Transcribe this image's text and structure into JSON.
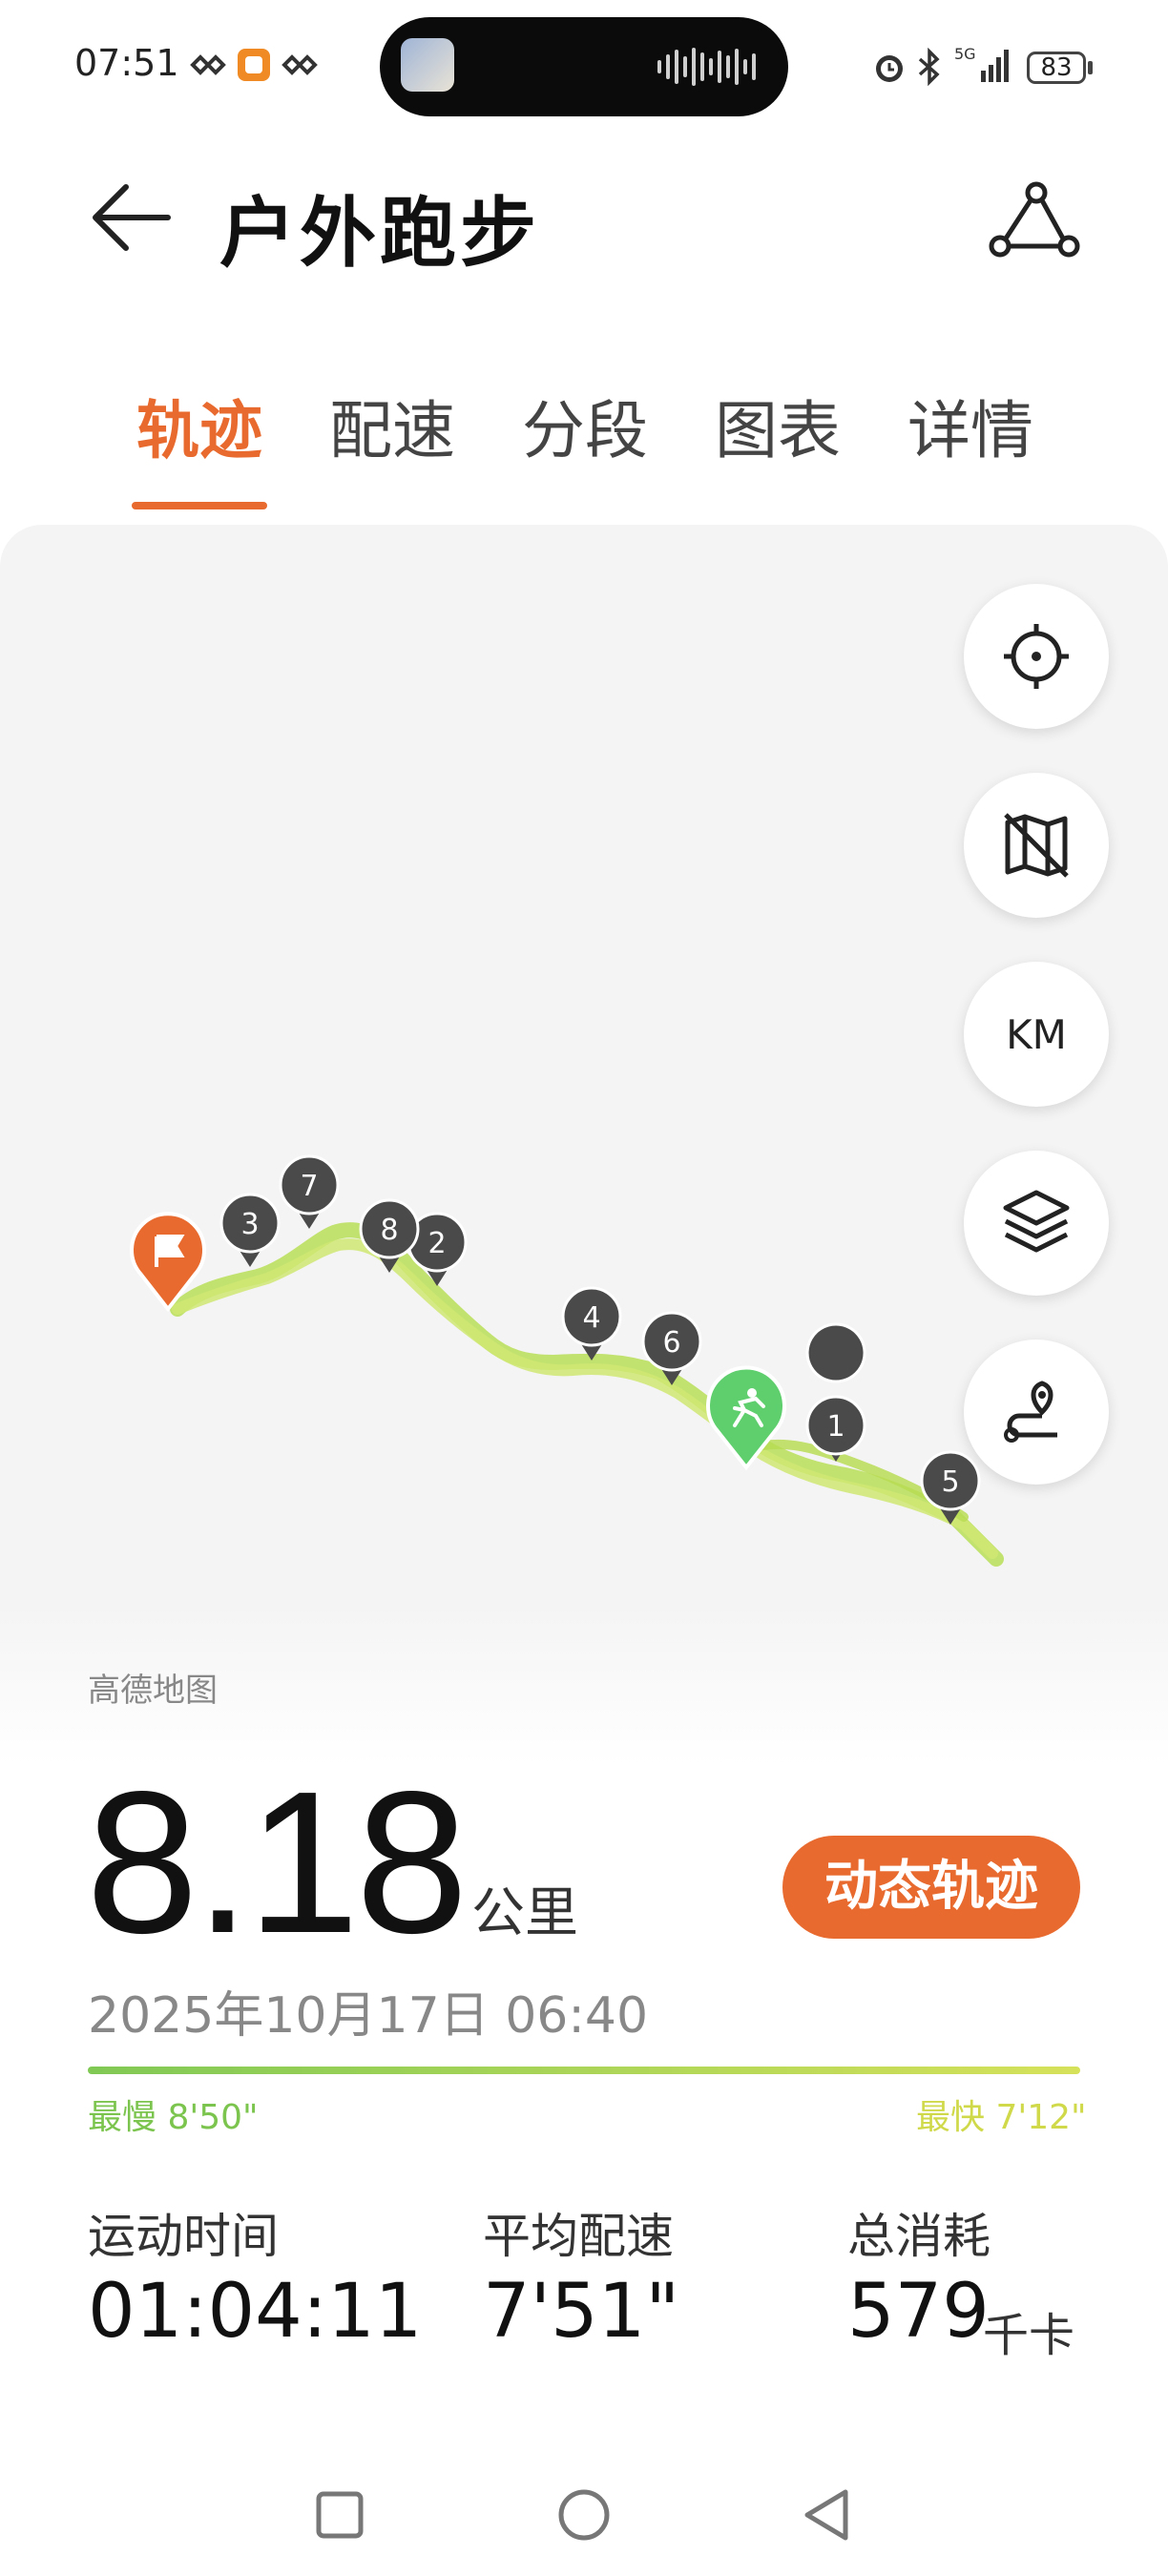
{
  "status_bar": {
    "time": "07:51",
    "battery": "83",
    "network": "5G"
  },
  "header": {
    "title": "户外跑步",
    "back_icon": "back-arrow-icon",
    "route_icon": "route-share-icon"
  },
  "tabs": [
    {
      "label": "轨迹",
      "active": true
    },
    {
      "label": "配速",
      "active": false
    },
    {
      "label": "分段",
      "active": false
    },
    {
      "label": "图表",
      "active": false
    },
    {
      "label": "详情",
      "active": false
    }
  ],
  "map": {
    "credit": "高德地图",
    "controls": [
      "locate-icon",
      "map-toggle-icon",
      "KM",
      "layers-icon",
      "route-marker-icon"
    ],
    "km_label": "KM",
    "km_markers": [
      "1",
      "2",
      "3",
      "4",
      "5",
      "6",
      "7",
      "8"
    ],
    "colors": {
      "track": "#b6df5c",
      "end_pin": "#e86a2e",
      "start_pin": "#5fcf6e",
      "marker": "#4a4a4a"
    }
  },
  "summary": {
    "distance": "8.18",
    "distance_unit": "公里",
    "dynamic_button": "动态轨迹",
    "datetime": "2025年10月17日 06:40",
    "slowest": "最慢 8'50\"",
    "fastest": "最快 7'12\""
  },
  "stats": [
    {
      "label": "运动时间",
      "value": "01:04:11",
      "unit": ""
    },
    {
      "label": "平均配速",
      "value": "7'51\"",
      "unit": ""
    },
    {
      "label": "总消耗",
      "value": "579",
      "unit": "千卡"
    }
  ],
  "accent": "#e86a2e"
}
